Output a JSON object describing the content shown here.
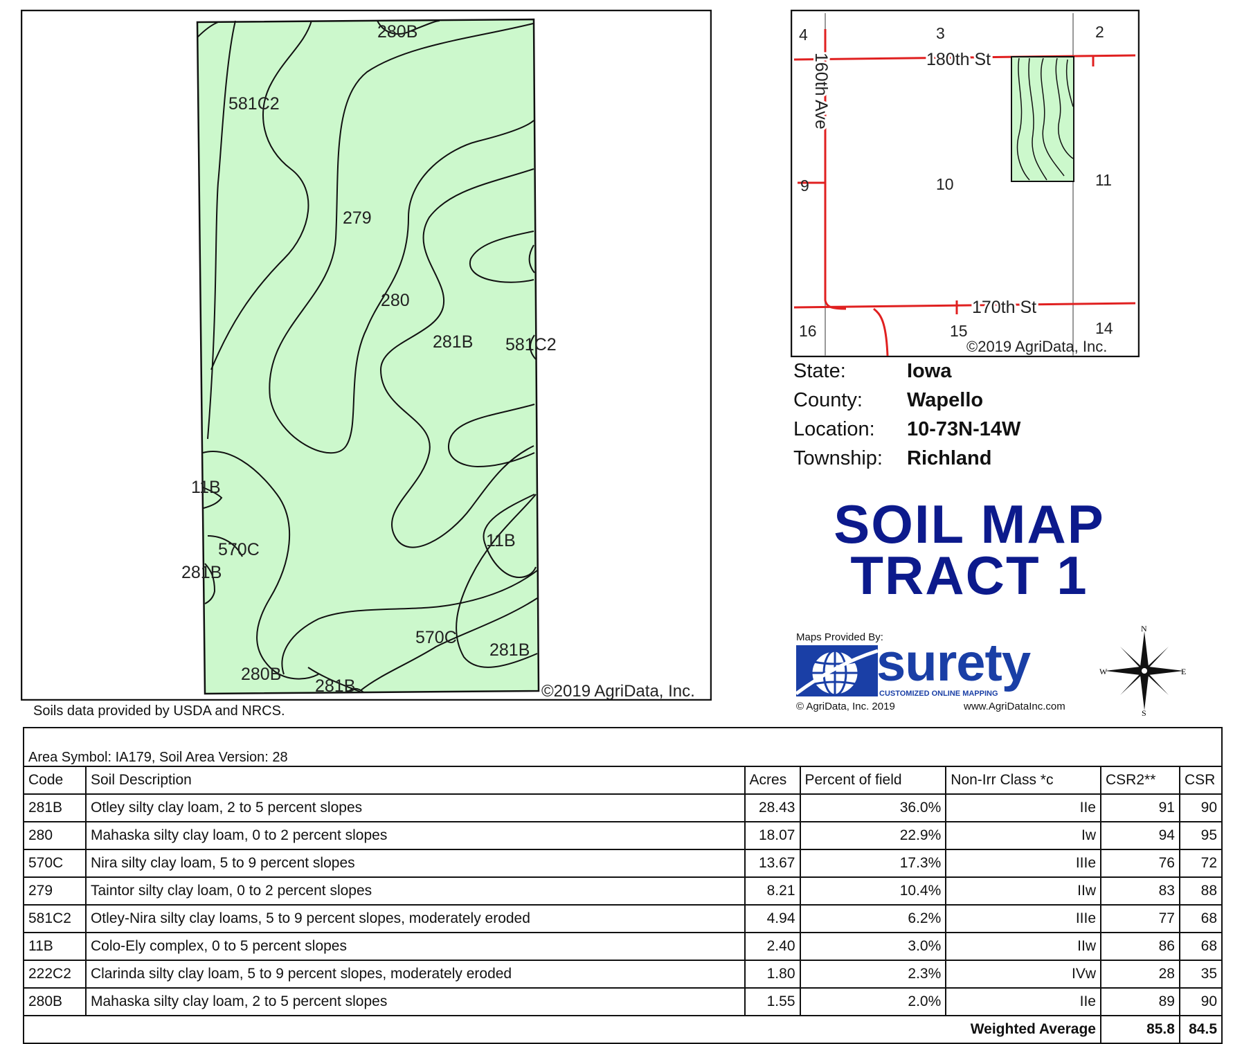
{
  "soil_map": {
    "labels": {
      "l1": "280B",
      "l2": "581C2",
      "l3": "279",
      "l4": "280",
      "l5": "281B",
      "l6": "581C2",
      "l7": "11B",
      "l8": "570C",
      "l9": "281B",
      "l10": "11B",
      "l11": "570C",
      "l12": "281B",
      "l13": "280B",
      "l14": "281B"
    },
    "copyright": "©2019 AgriData, Inc.",
    "fill_color": "#ccf8cc"
  },
  "location_map": {
    "sections": [
      "4",
      "3",
      "2",
      "9",
      "10",
      "11",
      "16",
      "15",
      "14"
    ],
    "roads": {
      "north": "180th St",
      "south": "170th St",
      "west": "160th Ave"
    },
    "copyright": "©2019 AgriData, Inc.",
    "road_color": "#e02020"
  },
  "info": {
    "state_label": "State:",
    "state": "Iowa",
    "county_label": "County:",
    "county": "Wapello",
    "location_label": "Location:",
    "location": "10-73N-14W",
    "township_label": "Township:",
    "township": "Richland"
  },
  "title": {
    "line1": "SOIL MAP",
    "line2": "TRACT 1",
    "color": "#0c1a8c"
  },
  "logo": {
    "provided_by": "Maps Provided By:",
    "brand": "surety",
    "tagline": "CUSTOMIZED ONLINE MAPPING",
    "copyright": "© AgriData, Inc. 2019",
    "url": "www.AgriDataInc.com"
  },
  "compass": {
    "n": "N",
    "s": "S",
    "e": "E",
    "w": "W"
  },
  "source_note": "Soils data provided by USDA and NRCS.",
  "table": {
    "area_symbol": "Area Symbol: IA179, Soil Area Version: 28",
    "headers": [
      "Code",
      "Soil Description",
      "Acres",
      "Percent of field",
      "Non-Irr Class *c",
      "CSR2**",
      "CSR"
    ],
    "rows": [
      [
        "281B",
        "Otley silty clay loam, 2 to 5 percent slopes",
        "28.43",
        "36.0%",
        "IIe",
        "91",
        "90"
      ],
      [
        "280",
        "Mahaska silty clay loam, 0 to 2 percent slopes",
        "18.07",
        "22.9%",
        "Iw",
        "94",
        "95"
      ],
      [
        "570C",
        "Nira silty clay loam, 5 to 9 percent slopes",
        "13.67",
        "17.3%",
        "IIIe",
        "76",
        "72"
      ],
      [
        "279",
        "Taintor silty clay loam, 0 to 2 percent slopes",
        "8.21",
        "10.4%",
        "IIw",
        "83",
        "88"
      ],
      [
        "581C2",
        "Otley-Nira silty clay loams, 5 to 9 percent slopes, moderately eroded",
        "4.94",
        "6.2%",
        "IIIe",
        "77",
        "68"
      ],
      [
        "11B",
        "Colo-Ely complex, 0 to 5 percent slopes",
        "2.40",
        "3.0%",
        "IIw",
        "86",
        "68"
      ],
      [
        "222C2",
        "Clarinda silty clay loam, 5 to 9 percent slopes, moderately eroded",
        "1.80",
        "2.3%",
        "IVw",
        "28",
        "35"
      ],
      [
        "280B",
        "Mahaska silty clay loam, 2 to 5 percent slopes",
        "1.55",
        "2.0%",
        "IIe",
        "89",
        "90"
      ]
    ],
    "weighted_label": "Weighted Average",
    "weighted_csr2": "85.8",
    "weighted_csr": "84.5"
  }
}
